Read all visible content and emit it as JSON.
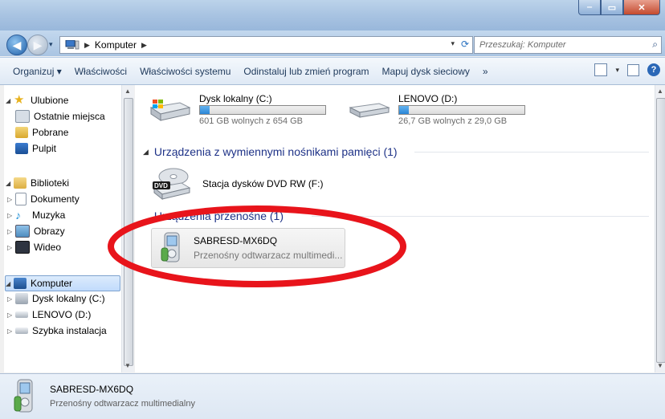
{
  "window": {
    "min_label": "‒",
    "max_label": "▭",
    "close_label": "✕"
  },
  "address": {
    "breadcrumb": "Komputer",
    "search_placeholder": "Przeszukaj: Komputer"
  },
  "toolbar": {
    "items": [
      "Organizuj ▾",
      "Właściwości",
      "Właściwości systemu",
      "Odinstaluj lub zmień program",
      "Mapuj dysk sieciowy",
      "»"
    ]
  },
  "nav": {
    "favorites": "Ulubione",
    "fav_items": [
      "Ostatnie miejsca",
      "Pobrane",
      "Pulpit"
    ],
    "libraries": "Biblioteki",
    "lib_items": [
      "Dokumenty",
      "Muzyka",
      "Obrazy",
      "Wideo"
    ],
    "computer": "Komputer",
    "comp_items": [
      "Dysk lokalny (C:)",
      "LENOVO (D:)",
      "Szybka instalacja"
    ]
  },
  "drives": [
    {
      "name": "Dysk lokalny (C:)",
      "free": "601 GB wolnych z 654 GB",
      "used_fraction": 0.08
    },
    {
      "name": "LENOVO (D:)",
      "free": "26,7 GB wolnych z 29,0 GB",
      "used_fraction": 0.08
    }
  ],
  "groups": {
    "removable": "Urządzenia z wymiennymi nośnikami pamięci (1)",
    "portable": "Urządzenia przenośne (1)"
  },
  "dvd": {
    "name": "Stacja dysków DVD RW (F:)",
    "badge": "DVD"
  },
  "device": {
    "name": "SABRESD-MX6DQ",
    "desc": "Przenośny odtwarzacz multimedi..."
  },
  "details": {
    "title": "SABRESD-MX6DQ",
    "subtitle": "Przenośny odtwarzacz multimedialny"
  },
  "colors": {
    "annotation": "#e8141b",
    "accent": "#2a86d6"
  }
}
